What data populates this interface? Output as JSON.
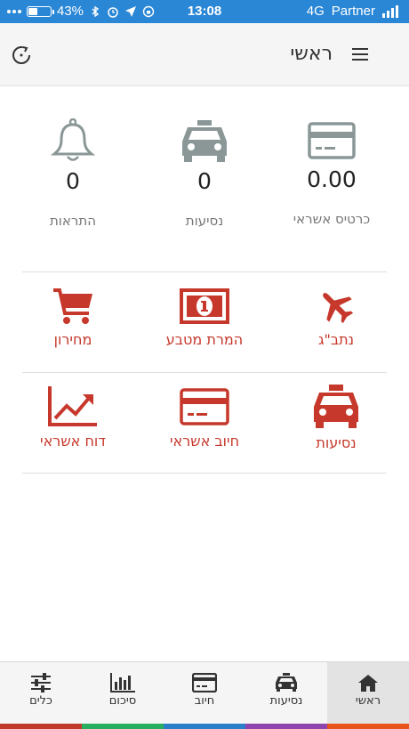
{
  "status_bar": {
    "battery": "43%",
    "battery_level": 0.43,
    "time": "13:08",
    "network": "4G",
    "carrier": "Partner"
  },
  "header": {
    "title": "ראשי"
  },
  "stats": [
    {
      "icon": "credit-card-icon",
      "value": "0.00",
      "label": "כרטיס אשראי"
    },
    {
      "icon": "taxi-icon",
      "value": "0",
      "label": "נסיעות"
    },
    {
      "icon": "bell-icon",
      "value": "0",
      "label": "התראות"
    }
  ],
  "tiles": [
    {
      "icon": "airplane-icon",
      "label": "נתב\"ג"
    },
    {
      "icon": "banknote-icon",
      "label": "המרת מטבע"
    },
    {
      "icon": "shopping-cart-icon",
      "label": "מחירון"
    },
    {
      "icon": "taxi-icon",
      "label": "נסיעות"
    },
    {
      "icon": "credit-card-icon",
      "label": "חיוב אשראי"
    },
    {
      "icon": "trend-chart-icon",
      "label": "דוח אשראי"
    }
  ],
  "tabs": [
    {
      "icon": "home-icon",
      "label": "ראשי",
      "active": true,
      "color": "#e8541c"
    },
    {
      "icon": "taxi-icon",
      "label": "נסיעות",
      "active": false,
      "color": "#8e44ad"
    },
    {
      "icon": "credit-card-icon",
      "label": "חיוב",
      "active": false,
      "color": "#2a7fc9"
    },
    {
      "icon": "bar-chart-icon",
      "label": "סיכום",
      "active": false,
      "color": "#27ae60"
    },
    {
      "icon": "sliders-icon",
      "label": "כלים",
      "active": false,
      "color": "#c0392b"
    }
  ],
  "colors": {
    "status_bar": "#2a87d6",
    "accent": "#c6382b",
    "stat_icon": "#8a9796"
  }
}
